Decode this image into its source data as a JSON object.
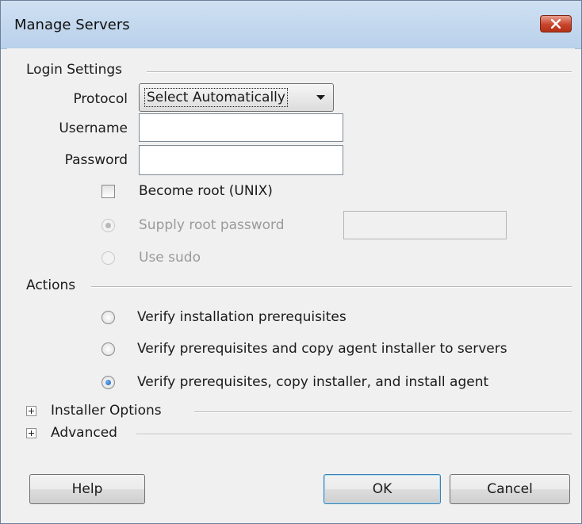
{
  "window": {
    "title": "Manage Servers"
  },
  "login": {
    "group_title": "Login Settings",
    "protocol_label": "Protocol",
    "protocol_value": "Select Automatically",
    "username_label": "Username",
    "username_value": "",
    "password_label": "Password",
    "password_value": "",
    "become_root_label": "Become root (UNIX)",
    "become_root_checked": false,
    "supply_root_password_label": "Supply root password",
    "root_password_value": "",
    "use_sudo_label": "Use sudo"
  },
  "actions": {
    "group_title": "Actions",
    "options": [
      {
        "label": "Verify installation prerequisites",
        "selected": false
      },
      {
        "label": "Verify prerequisites and copy agent installer to servers",
        "selected": false
      },
      {
        "label": "Verify prerequisites, copy installer, and install agent",
        "selected": true
      }
    ]
  },
  "sections": {
    "installer_options": "Installer Options",
    "advanced": "Advanced"
  },
  "buttons": {
    "help": "Help",
    "ok": "OK",
    "cancel": "Cancel"
  },
  "colors": {
    "title_bar": "#b9d1ea",
    "close_button": "#c7432b",
    "dialog_bg": "#f0f0f0"
  },
  "icons": {
    "close": "close-icon",
    "dropdown": "chevron-down-icon",
    "expand": "plus-box-icon"
  }
}
